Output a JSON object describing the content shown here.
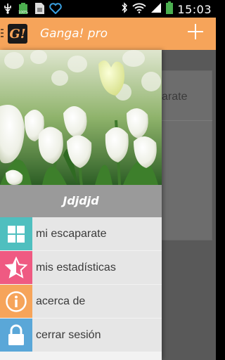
{
  "status_bar": {
    "time": "15:03",
    "battery_percent": 100,
    "icons": [
      "usb-icon",
      "battery-percent-icon",
      "sim-icon",
      "heart-icon",
      "bluetooth-icon",
      "wifi-icon",
      "signal-icon",
      "battery-icon"
    ]
  },
  "app_bar": {
    "logo_text": "G!",
    "title": "Ganga! pro",
    "add_icon": "plus-icon"
  },
  "background": {
    "card_text": "arate"
  },
  "drawer": {
    "username": "Jdjdjd",
    "menu": [
      {
        "label": "mi escaparate",
        "icon": "grid-icon",
        "color": "#4fbfbf"
      },
      {
        "label": "mis estadísticas",
        "icon": "star-half-icon",
        "color": "#ef5a82"
      },
      {
        "label": "acerca de",
        "icon": "info-icon",
        "color": "#f6a45a"
      },
      {
        "label": "cerrar sesión",
        "icon": "lock-icon",
        "color": "#5aa7d8"
      }
    ]
  },
  "colors": {
    "accent": "#f6a45a",
    "username_bar": "#9a9a9a"
  }
}
